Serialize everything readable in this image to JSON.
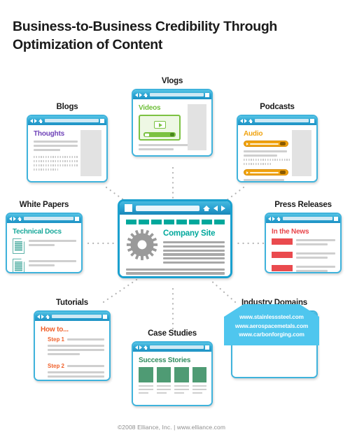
{
  "title": "Business-to-Business Credibility Through Optimization of Content",
  "footer": "©2008 Elliance, Inc.   |   www.elliance.com",
  "colors": {
    "window_border": "#3fb3dc",
    "titlebar": "#2fa7d4",
    "center_accent": "#00a89c",
    "blogs": "#6f42b8",
    "vlogs": "#6fbf3b",
    "podcasts": "#f0a310",
    "white_papers": "#17a89a",
    "press_releases": "#e8454a",
    "tutorials": "#f0602a",
    "case_studies": "#2f8c5e",
    "industry_domains": "#4fc6ee"
  },
  "center": {
    "label": "Company Site",
    "nav_segments": 8,
    "icons": [
      "home-icon",
      "back-icon",
      "forward-icon"
    ]
  },
  "nodes": {
    "blogs": {
      "label": "Blogs",
      "heading": "Thoughts"
    },
    "vlogs": {
      "label": "Vlogs",
      "heading": "Videos"
    },
    "podcasts": {
      "label": "Podcasts",
      "heading": "Audio"
    },
    "white_papers": {
      "label": "White Papers",
      "heading": "Technical Docs"
    },
    "press_releases": {
      "label": "Press Releases",
      "heading": "In the News"
    },
    "tutorials": {
      "label": "Tutorials",
      "heading": "How to...",
      "step1": "Step 1",
      "step2": "Step 2"
    },
    "case_studies": {
      "label": "Case Studies",
      "heading": "Success Stories"
    },
    "industry_domains": {
      "label": "Industry Domains",
      "urls": [
        "www.stainlesssteel.com",
        "www.aerospacemetals.com",
        "www.carbonforging.com"
      ]
    }
  }
}
